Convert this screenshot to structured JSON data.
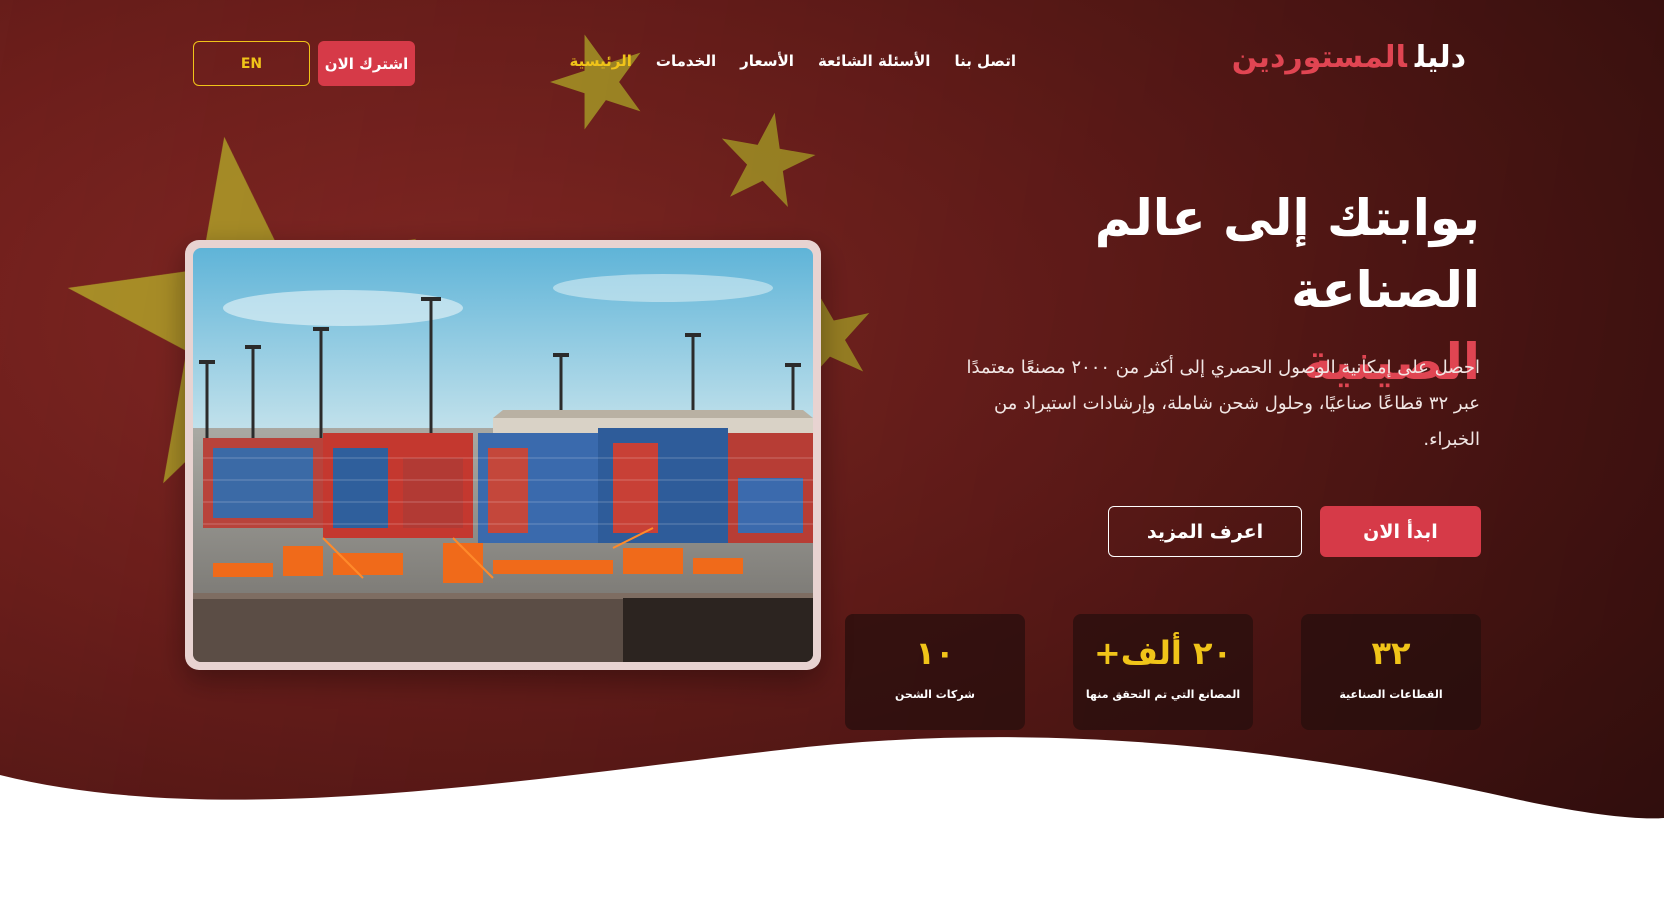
{
  "header": {
    "logo_part1": "دليل",
    "logo_part2": "المستوردين",
    "nav": [
      {
        "label": "الرئيسية",
        "active": true
      },
      {
        "label": "الخدمات",
        "active": false
      },
      {
        "label": "الأسعار",
        "active": false
      },
      {
        "label": "الأسئلة الشائعة",
        "active": false
      },
      {
        "label": "اتصل بنا",
        "active": false
      }
    ],
    "subscribe_label": "اشترك الان",
    "language_label": "EN"
  },
  "hero": {
    "title_line1": "بوابتك إلى عالم الصناعة",
    "title_line2": "الصينية",
    "description": "احصل على إمكانية الوصول الحصري إلى أكثر من ٢٠٠٠ مصنعًا معتمدًا عبر ٣٢ قطاعًا صناعيًا، وحلول شحن شاملة، وإرشادات استيراد من الخبراء.",
    "start_label": "ابدأ الان",
    "more_label": "اعرف المزيد"
  },
  "stats": [
    {
      "value": "٣٢",
      "label": "القطاعات الصناعية"
    },
    {
      "value": "٢٠ ألف+",
      "label": "المصانع التي تم التحقق منها"
    },
    {
      "value": "١٠",
      "label": "شركات الشحن"
    }
  ],
  "colors": {
    "accent_red": "#d63a48",
    "accent_yellow": "#f0c419",
    "background_red": "#6e1f1c"
  },
  "icons": {
    "flag_star": "five-point-star"
  }
}
